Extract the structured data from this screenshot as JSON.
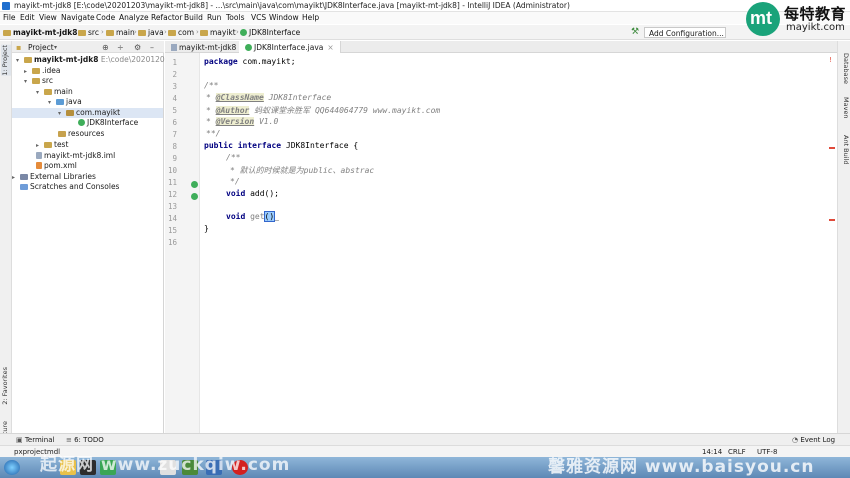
{
  "window": {
    "title": "mayikt-mt-jdk8 [E:\\code\\20201203\\mayikt-mt-jdk8] - ...\\src\\main\\java\\com\\mayikt\\JDK8Interface.java [mayikt-mt-jdk8] - IntelliJ IDEA (Administrator)"
  },
  "menu": [
    "File",
    "Edit",
    "View",
    "Navigate",
    "Code",
    "Analyze",
    "Refactor",
    "Build",
    "Run",
    "Tools",
    "VCS",
    "Window",
    "Help"
  ],
  "brand": {
    "logo": "mt",
    "name": "每特教育",
    "url": "mayikt.com"
  },
  "navbar": {
    "crumbs": [
      "mayikt-mt-jdk8",
      "src",
      "main",
      "java",
      "com",
      "mayikt",
      "JDK8Interface"
    ],
    "run_config": "Add Configuration..."
  },
  "left_strip": {
    "project": "1: Project",
    "favorites": "2: Favorites",
    "structure": "Z: Structure"
  },
  "project_panel": {
    "title": "Project",
    "tree": [
      {
        "label": "mayikt-mt-jdk8",
        "hint": "E:\\code\\20201203\\ma",
        "arrow": "▾",
        "icon": "folder"
      },
      {
        "label": ".idea",
        "arrow": "▸",
        "icon": "folder"
      },
      {
        "label": "src",
        "arrow": "▾",
        "icon": "folder"
      },
      {
        "label": "main",
        "arrow": "▾",
        "icon": "folder"
      },
      {
        "label": "java",
        "arrow": "▾",
        "icon": "src"
      },
      {
        "label": "com.mayikt",
        "arrow": "▾",
        "icon": "pkg"
      },
      {
        "label": "JDK8Interface",
        "arrow": "",
        "icon": "iface"
      },
      {
        "label": "resources",
        "arrow": "",
        "icon": "res"
      },
      {
        "label": "test",
        "arrow": "▸",
        "icon": "folder"
      },
      {
        "label": "mayikt-mt-jdk8.iml",
        "arrow": "",
        "icon": "file"
      },
      {
        "label": "pom.xml",
        "arrow": "",
        "icon": "xml"
      },
      {
        "label": "External Libraries",
        "arrow": "▸",
        "icon": "lib"
      },
      {
        "label": "Scratches and Consoles",
        "arrow": "",
        "icon": "scratch"
      }
    ]
  },
  "editor": {
    "tabs": [
      "mayikt-mt-jdk8",
      "JDK8Interface.java"
    ],
    "line_numbers": [
      "1",
      "2",
      "3",
      "4",
      "5",
      "6",
      "7",
      "8",
      "9",
      "10",
      "11",
      "12",
      "13",
      "14",
      "15",
      "16"
    ],
    "lines": {
      "l1_kw": "package",
      "l1_rest": " com.mayikt;",
      "l4": "/**",
      "l5_tag": "@ClassName",
      "l5_rest": " JDK8Interface",
      "l6_tag": "@Author",
      "l6_rest": " 蚂蚁课堂余胜军 QQ644064779 www.mayikt.com",
      "l7_tag": "@Version",
      "l7_rest": " V1.0",
      "l8": "**/",
      "l9_kw1": "public",
      "l9_kw2": "interface",
      "l9_rest": " JDK8Interface {",
      "l10": "/**",
      "l11": "* 默认的时候就是为public、abstrac",
      "l12": "*/",
      "l13_kw": "void",
      "l13_rest": " add();",
      "l14_kw": "void",
      "l14_name": " get",
      "l14_paren": "()",
      "l14_tail": "_",
      "l15": "}"
    }
  },
  "right_strip": {
    "database": "Database",
    "maven": "Maven",
    "ant": "Ant Build"
  },
  "bottom_bar": {
    "terminal": "Terminal",
    "todo": "6: TODO",
    "event_log": "Event Log"
  },
  "status_bar": {
    "message": "pxprojectmdl",
    "position": "14:14",
    "line_sep": "CRLF",
    "encoding": "UTF-8"
  },
  "watermarks": {
    "left": "起源网 www.zuckqiw.com",
    "right": "馨雅资源网 www.baisyou.cn"
  }
}
